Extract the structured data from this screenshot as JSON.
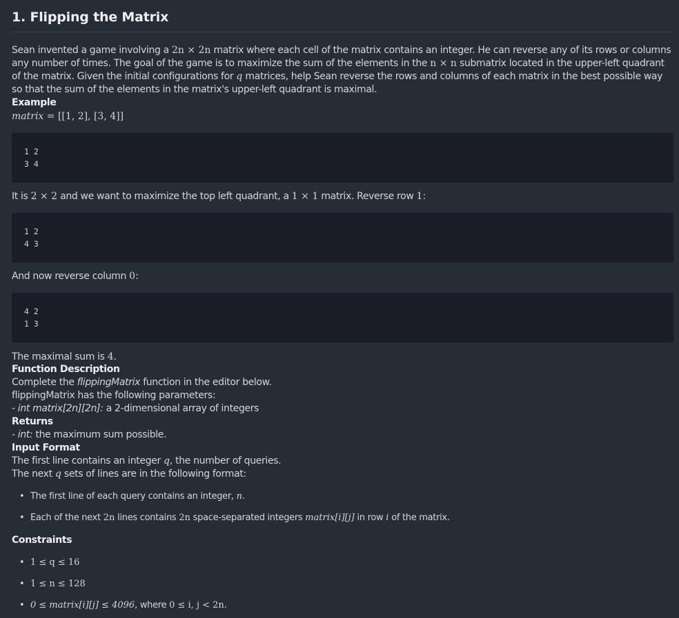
{
  "title": "1. Flipping the Matrix",
  "intro": {
    "a": "Sean invented a game involving a ",
    "m1": "2n × 2n",
    "b": " matrix where each cell of the matrix contains an integer. He can reverse any of its rows or columns any number of times. The goal of the game is to maximize the sum of the elements in the ",
    "m2": "n × n",
    "c": " submatrix located in the upper-left quadrant of the matrix. Given the initial configurations for ",
    "m3": "q",
    "d": " matrices, help Sean reverse the rows and columns of each matrix in the best possible way so that the sum of the elements in the matrix's upper-left quadrant is maximal."
  },
  "example": {
    "heading": "Example",
    "matrix_label": "matrix",
    "matrix_value": " = [[1, 2], [3, 4]]",
    "code1": "1 2\n3 4",
    "step1": {
      "a": "It is ",
      "m1": "2 × 2",
      "b": " and we want to maximize the top left quadrant, a ",
      "m2": "1 × 1",
      "c": " matrix. Reverse row ",
      "m3": "1",
      "d": ":"
    },
    "code2": "1 2\n4 3",
    "step2": {
      "a": "And now reverse column ",
      "m1": "0",
      "b": ":"
    },
    "code3": "4 2\n1 3",
    "result": {
      "a": "The maximal sum is ",
      "m1": "4",
      "b": "."
    }
  },
  "function_description": {
    "heading": "Function Description",
    "line1_a": "Complete the ",
    "line1_fn": "flippingMatrix",
    "line1_b": " function in the editor below.",
    "line2": "flippingMatrix has the following parameters:",
    "param_type": "- int matrix[2n][2n]:",
    "param_desc": " a 2-dimensional array of integers"
  },
  "returns": {
    "heading": "Returns",
    "type": "- int:",
    "desc": " the maximum sum possible."
  },
  "input_format": {
    "heading": "Input Format",
    "line1_a": "The first line contains an integer ",
    "line1_m": "q",
    "line1_b": ", the number of queries.",
    "line2_a": "The next ",
    "line2_m": "q",
    "line2_b": " sets of lines are in the following format:",
    "bullet1_a": "The first line of each query contains an integer, ",
    "bullet1_m": "n",
    "bullet1_b": ".",
    "bullet2_a": "Each of the next ",
    "bullet2_m1": "2n",
    "bullet2_b": " lines contains ",
    "bullet2_m2": "2n",
    "bullet2_c": " space-separated integers ",
    "bullet2_m3": "matrix[i][j]",
    "bullet2_d": " in row ",
    "bullet2_m4": "i",
    "bullet2_e": " of the matrix."
  },
  "constraints": {
    "heading": "Constraints",
    "c1": "1 ≤ q ≤ 16",
    "c2": "1 ≤ n ≤ 128",
    "c3_m": "0 ≤ matrix[i][j] ≤ 4096",
    "c3_a": ", where ",
    "c3_m2": "0 ≤ i, j < 2n",
    "c3_b": "."
  },
  "bullet_glyph": "•"
}
